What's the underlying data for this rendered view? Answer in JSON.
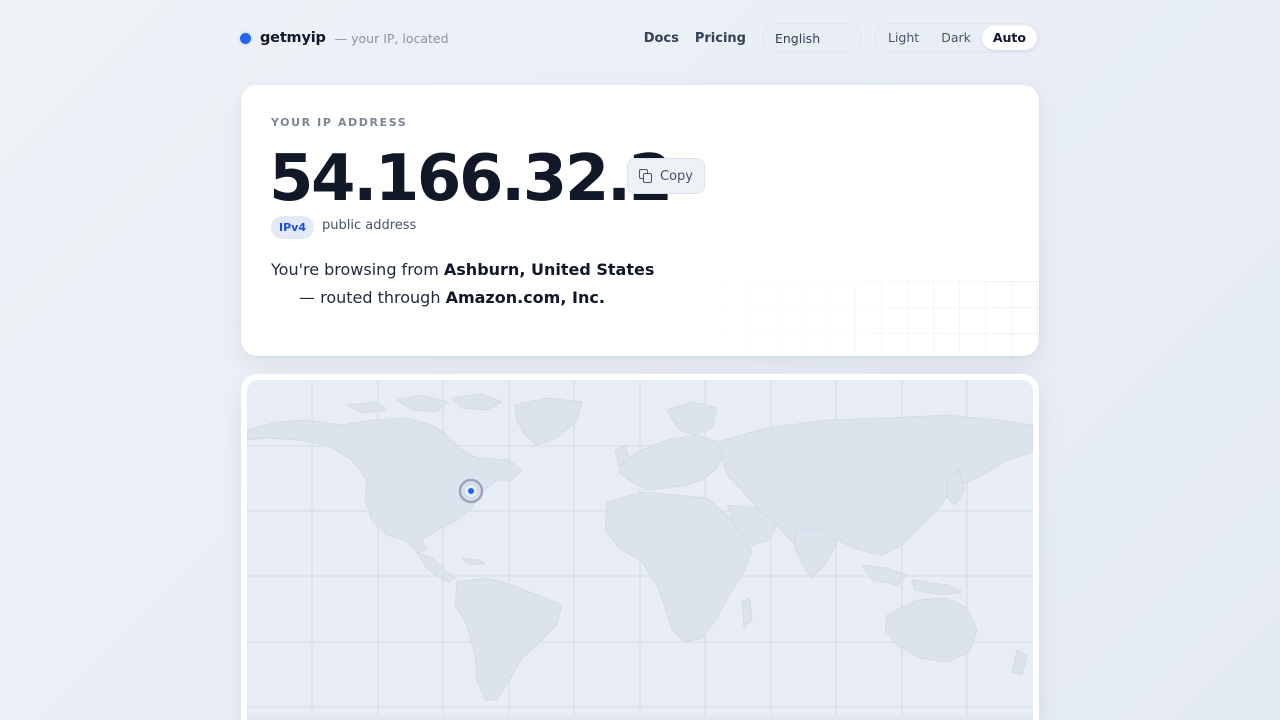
{
  "brand": {
    "name": "getmyip",
    "tagline": "— your IP, located",
    "accent": "#2563eb"
  },
  "nav": {
    "links": [
      "Docs",
      "Pricing"
    ],
    "language": "English",
    "theme_options": [
      "Light",
      "Dark",
      "Auto"
    ],
    "theme_selected": "Auto"
  },
  "ip_card": {
    "label": "YOUR IP ADDRESS",
    "ip": "54.166.32.2",
    "copy_label": "Copy",
    "version_badge": "IPv4",
    "address_type": "public address",
    "location_prefix": "You're browsing from",
    "location": "Ashburn, United States",
    "route_prefix": "— routed through",
    "isp": "Amazon.com, Inc."
  },
  "map": {
    "marker_label": "",
    "marker_color": "#2563eb",
    "land_color": "#dde4ee",
    "water_color": "#e8edf5"
  }
}
